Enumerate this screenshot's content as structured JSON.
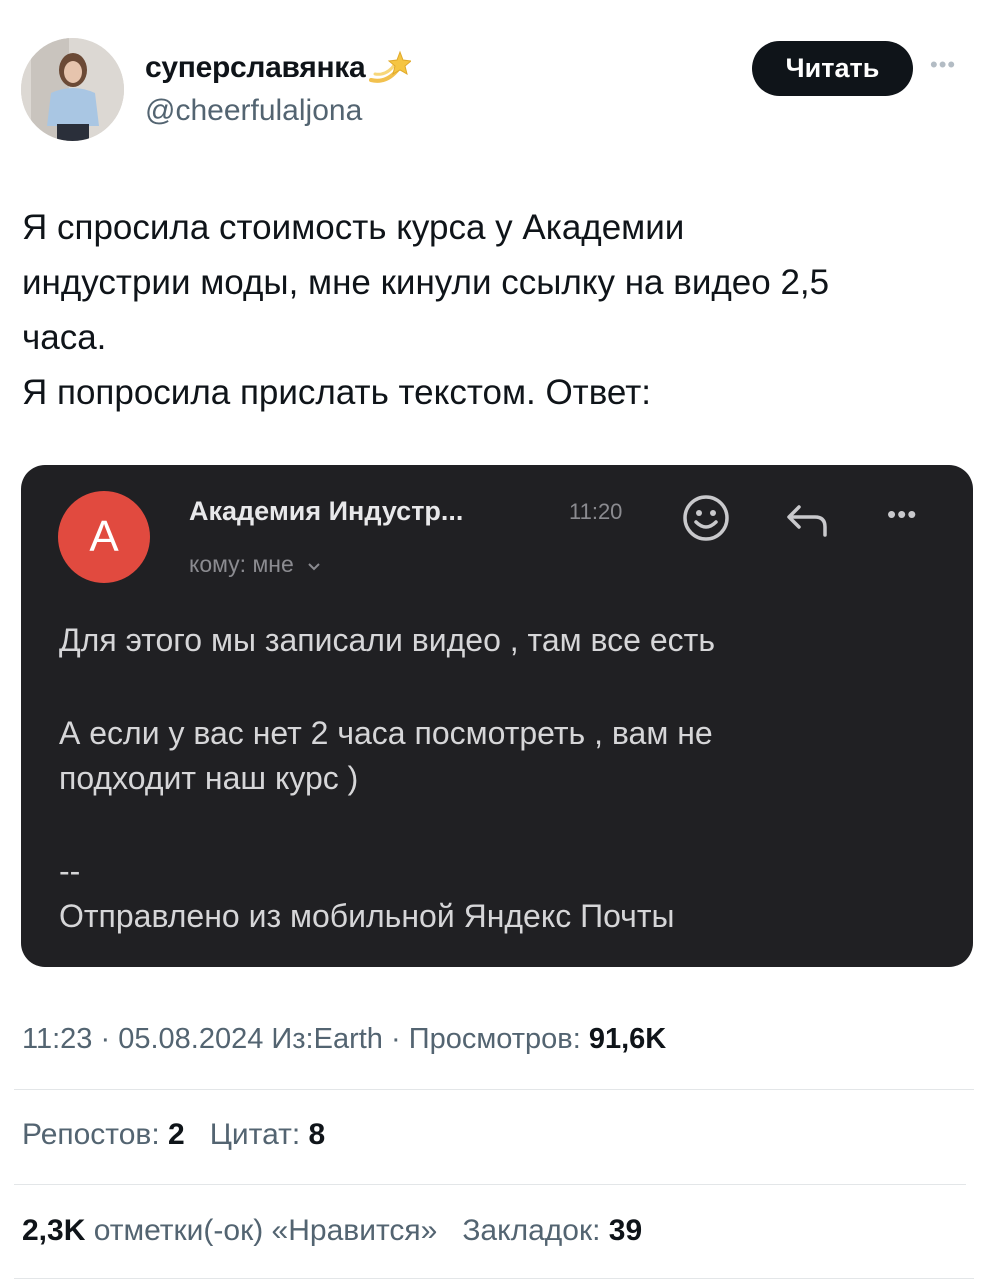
{
  "header": {
    "display_name": "суперславянка",
    "handle": "@cheerfulaljona",
    "follow_label": "Читать",
    "more_label": "•••"
  },
  "tweet": {
    "text": "Я спросила стоимость курса у Академии\nиндустрии моды, мне кинули ссылку на видео 2,5\nчаса.\nЯ попросила прислать текстом. Ответ:"
  },
  "email": {
    "avatar_letter": "А",
    "sender": "Академия Индустр...",
    "time": "11:20",
    "recipient": "кому: мне",
    "more_label": "•••",
    "body": [
      "Для этого мы записали видео , там все есть",
      "А если у вас нет 2 часа посмотреть , вам не",
      "подходит наш курс )",
      "--",
      "Отправлено из мобильной Яндекс Почты"
    ]
  },
  "meta": {
    "time": "11:23",
    "date": "05.08.2024",
    "source": "Из:Earth",
    "views_label": "Просмотров:",
    "views_value": "91,6K"
  },
  "stats": {
    "reposts_label": "Репостов:",
    "reposts_value": "2",
    "quotes_label": "Цитат:",
    "quotes_value": "8",
    "likes_value": "2,3K",
    "likes_label": "отметки(-ок) «Нравится»",
    "bookmarks_label": "Закладок:",
    "bookmarks_value": "39"
  },
  "colors": {
    "primary_text": "#0f1419",
    "secondary_text": "#536471",
    "media_bg": "#202023",
    "mail_avatar": "#e14a3f"
  }
}
